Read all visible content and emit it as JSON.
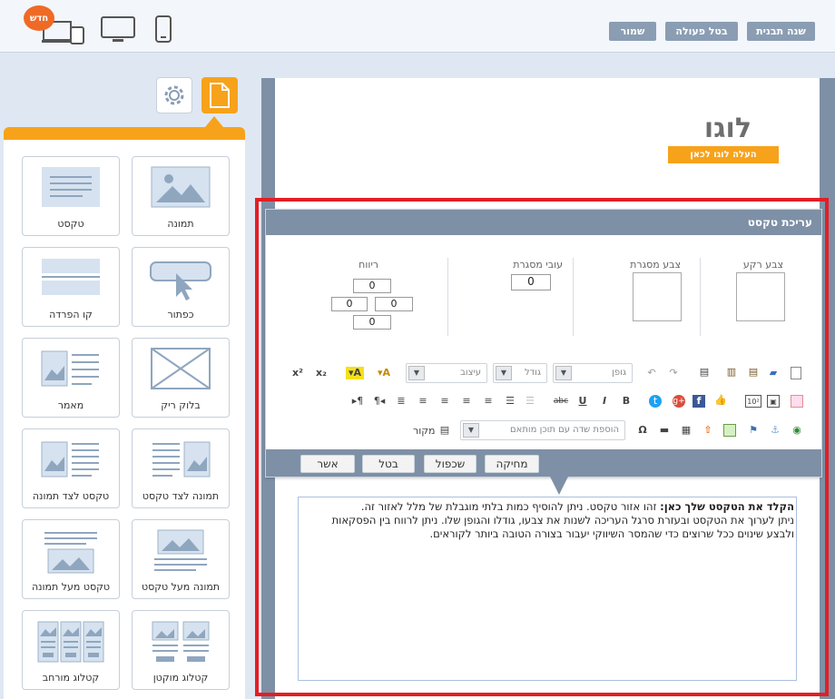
{
  "toolbar": {
    "change_template": "שנה תבנית",
    "undo": "בטל פעולה",
    "save": "שמור",
    "new_badge": "חדש"
  },
  "devices": [
    "desktop-mobile",
    "desktop",
    "mobile"
  ],
  "page": {
    "logo_text": "לוגו",
    "upload_logo": "העלה לוגו לכאן"
  },
  "blocks": [
    {
      "label": "תמונה"
    },
    {
      "label": "טקסט"
    },
    {
      "label": "כפתור"
    },
    {
      "label": "קו הפרדה"
    },
    {
      "label": "בלוק ריק"
    },
    {
      "label": "מאמר"
    },
    {
      "label": "תמונה לצד טקסט"
    },
    {
      "label": "טקסט לצד תמונה"
    },
    {
      "label": "תמונה מעל טקסט"
    },
    {
      "label": "טקסט מעל תמונה"
    },
    {
      "label": "קטלוג מוקטן"
    },
    {
      "label": "קטלוג מורחב"
    }
  ],
  "editor": {
    "title": "עריכת טקסט",
    "bg_color_label": "צבע רקע",
    "border_color_label": "צבע מסגרת",
    "border_width_label": "עובי מסגרת",
    "border_width_value": "0",
    "padding_label": "ריווח",
    "padding": {
      "top": "0",
      "left": "0",
      "right": "0",
      "bottom": "0"
    },
    "font_placeholder": "גופן",
    "size_placeholder": "גודל",
    "style_placeholder": "עיצוב",
    "add_field_placeholder": "הוספת שדה עם תוכן מותאם",
    "source_label": "מקור",
    "buttons": {
      "delete": "מחיקה",
      "duplicate": "שכפול",
      "cancel": "בטל",
      "confirm": "אשר"
    },
    "content_bold": "הקלד את הטקסט שלך כאן:",
    "content_line1": " זהו אזור טקסט. ניתן להוסיף כמות בלתי מוגבלת של מלל לאזור זה.",
    "content_line2": "ניתן לערוך את הטקסט ובעזרת סרגל העריכה לשנות את צבעו, גודלו והגופן שלו. ניתן לרווח בין הפסקאות",
    "content_line3": "ולבצע שינוים ככל שרוצים כדי שהמסר השיווקי יעבור בצורה הטובה ביותר לקוראים."
  },
  "colors": {
    "accent": "#f7a21b",
    "header": "#7e90a6",
    "highlight": "#e31e24",
    "badge": "#ef6a27"
  }
}
